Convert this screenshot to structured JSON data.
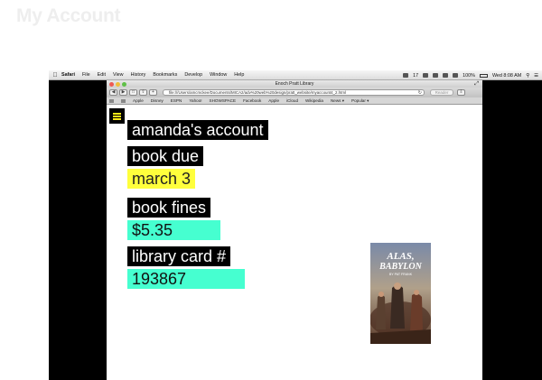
{
  "slide": {
    "title": "My Account"
  },
  "mac_menubar": {
    "apple": "",
    "items": [
      "Safari",
      "File",
      "Edit",
      "View",
      "History",
      "Bookmarks",
      "Develop",
      "Window",
      "Help"
    ],
    "status": {
      "badge": "17",
      "battery": "100%",
      "clock": "Wed 8:08 AM"
    }
  },
  "browser": {
    "window_title": "Enoch Pratt Library",
    "url": "file:///Users/amcmckee/Documents/MICA2/adv%20web%20design/pratt_website/myaccount4_2.html",
    "reader_label": "Reader",
    "bookmarks": [
      "Apple",
      "Disney",
      "ESPN",
      "Yahoo!",
      "SHOWSPACE",
      "Facebook",
      "Apple",
      "iCloud",
      "Wikipedia",
      "News ▾",
      "Popular ▾"
    ]
  },
  "account": {
    "heading": "amanda's account",
    "book_due_label": "book due",
    "book_due_value": "march 3",
    "fines_label": "book fines",
    "fines_value": "$5.35",
    "card_label": "library card #",
    "card_value": "193867"
  },
  "book_cover": {
    "title_line1": "ALAS,",
    "title_line2": "BABYLON",
    "author": "BY PAT FRANK"
  },
  "colors": {
    "accent_yellow": "#ffff3c",
    "accent_aqua": "#46ffd0",
    "menu_icon": "#ffe817"
  }
}
